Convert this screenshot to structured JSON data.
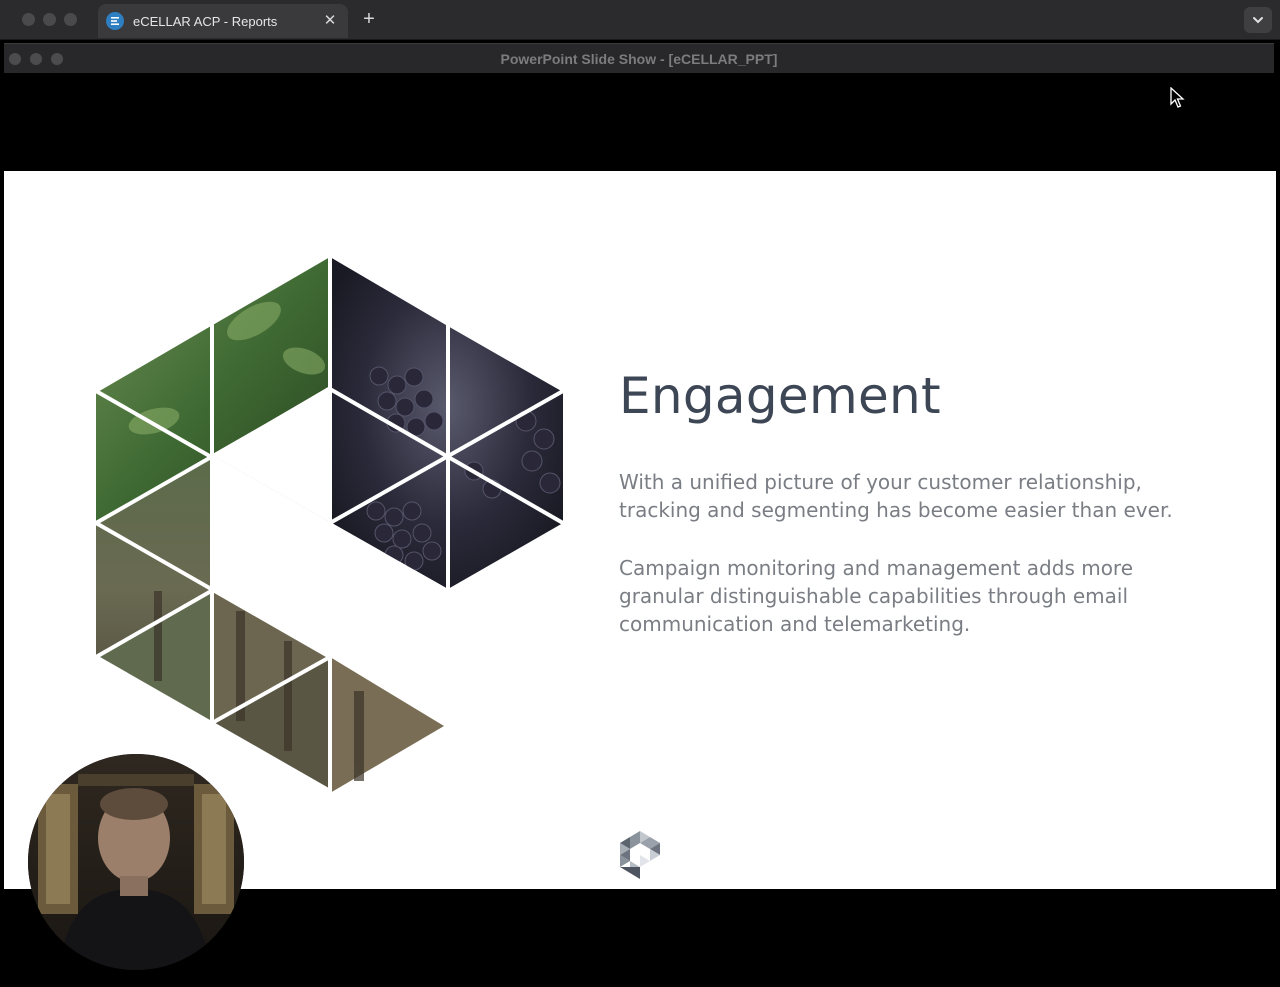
{
  "browser": {
    "tab": {
      "title": "eCELLAR ACP - Reports",
      "close_glyph": "✕",
      "favicon_icon": "ecellar-favicon-icon"
    },
    "new_tab_glyph": "+",
    "tab_menu_icon": "chevron-down-icon"
  },
  "slideshow_window": {
    "title": "PowerPoint Slide Show - [eCELLAR_PPT]"
  },
  "slide": {
    "title": "Engagement",
    "paragraph_1": "With a unified picture of your customer relationship, tracking and segmenting has become easier than ever.",
    "paragraph_2": "Campaign monitoring and management adds more granular distinguishable capabilities through email communication and telemarketing.",
    "colors": {
      "title": "#3d4654",
      "body": "#7a7e84",
      "background": "#ffffff"
    }
  },
  "colors": {
    "chrome_bg": "#2b2b2d",
    "tab_bg": "#3a3a3c",
    "favicon": "#2d7fc1"
  }
}
